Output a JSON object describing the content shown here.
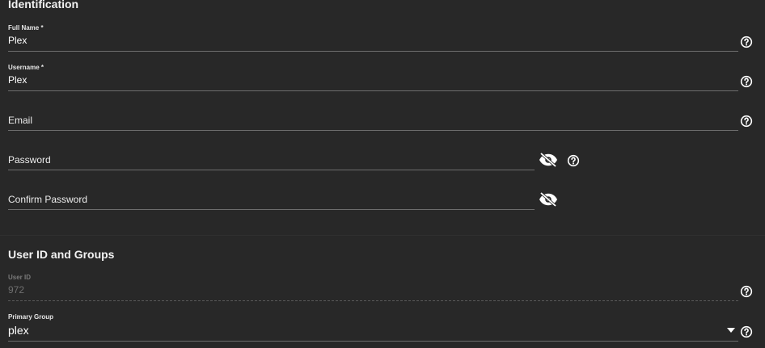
{
  "sections": {
    "identification_title": "Identification",
    "groups_title": "User ID and Groups"
  },
  "fields": {
    "full_name": {
      "label": "Full Name *",
      "value": "Plex"
    },
    "username": {
      "label": "Username *",
      "value": "Plex"
    },
    "email": {
      "label": "Email"
    },
    "password": {
      "label": "Password"
    },
    "confirm_password": {
      "label": "Confirm Password"
    },
    "user_id": {
      "label": "User ID",
      "value": "972"
    },
    "primary_group": {
      "label": "Primary Group",
      "value": "plex"
    }
  },
  "icons": {
    "help": "help-circle-icon",
    "visibility": "eye-off-icon",
    "dropdown": "caret-down-icon"
  },
  "colors": {
    "background": "#282828",
    "underline": "#6d6d6d",
    "text": "#ffffff"
  }
}
